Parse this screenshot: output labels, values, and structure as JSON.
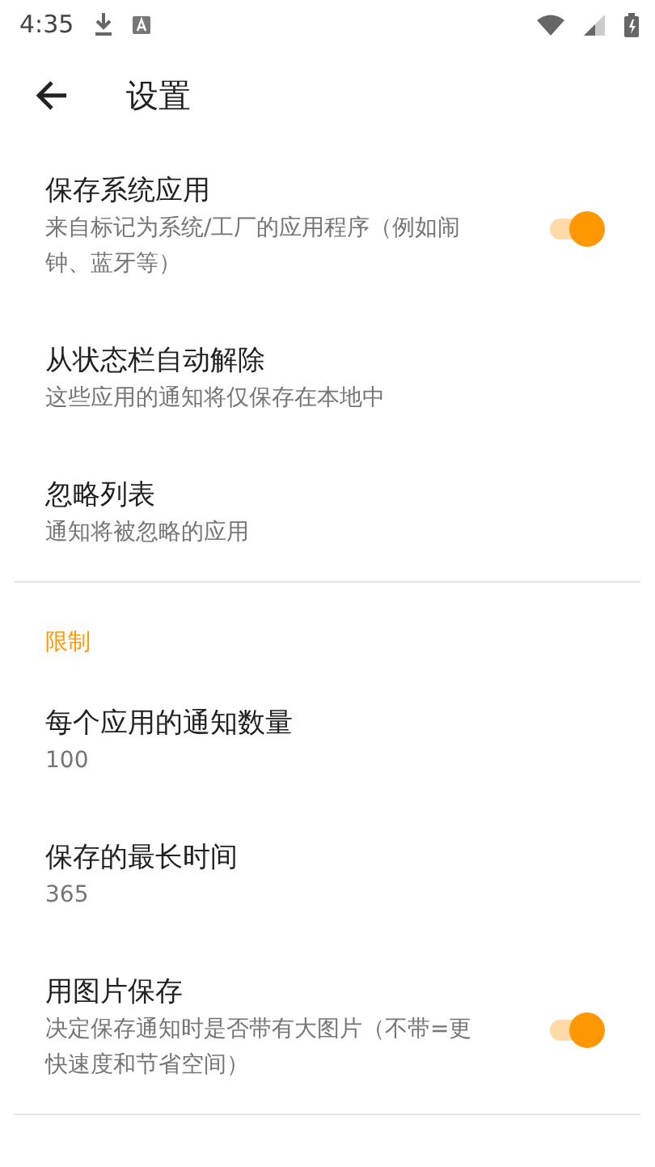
{
  "status_bar": {
    "time": "4:35"
  },
  "toolbar": {
    "title": "设置"
  },
  "sections": [
    {
      "items": [
        {
          "kind": "switch",
          "title": "保存系统应用",
          "subtitle": "来自标记为系统/工厂的应用程序（例如闹钟、蓝牙等）",
          "on": true
        },
        {
          "kind": "text",
          "title": "从状态栏自动解除",
          "subtitle": "这些应用的通知将仅保存在本地中"
        },
        {
          "kind": "text",
          "title": "忽略列表",
          "subtitle": "通知将被忽略的应用"
        }
      ]
    },
    {
      "header": "限制",
      "items": [
        {
          "kind": "text",
          "title": "每个应用的通知数量",
          "subtitle": "100"
        },
        {
          "kind": "text",
          "title": "保存的最长时间",
          "subtitle": "365"
        },
        {
          "kind": "switch",
          "title": "用图片保存",
          "subtitle": "决定保存通知时是否带有大图片（不带=更快速度和节省空间）",
          "on": true
        }
      ]
    }
  ]
}
